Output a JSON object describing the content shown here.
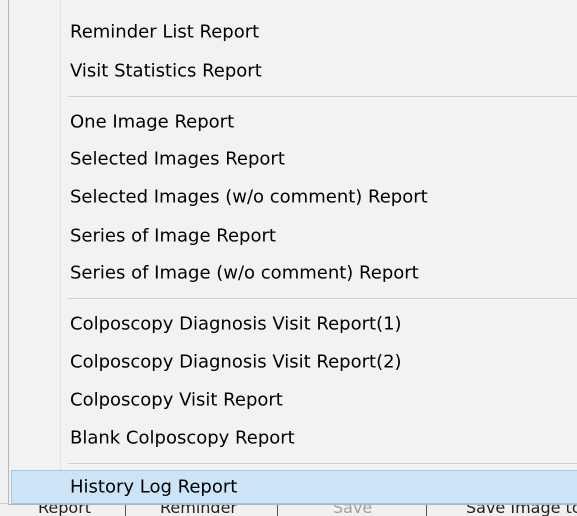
{
  "menu": {
    "groups": [
      {
        "items": [
          {
            "label": "Reminder List Report"
          },
          {
            "label": "Visit Statistics Report"
          }
        ]
      },
      {
        "items": [
          {
            "label": "One Image Report"
          },
          {
            "label": "Selected Images Report"
          },
          {
            "label": "Selected Images (w/o comment) Report"
          },
          {
            "label": "Series of Image Report"
          },
          {
            "label": "Series of Image (w/o comment) Report"
          }
        ]
      },
      {
        "items": [
          {
            "label": "Colposcopy Diagnosis Visit Report(1)"
          },
          {
            "label": "Colposcopy Diagnosis Visit Report(2)"
          },
          {
            "label": "Colposcopy Visit Report"
          },
          {
            "label": "Blank Colposcopy Report"
          }
        ]
      },
      {
        "items": [
          {
            "label": "History Log Report",
            "highlighted": true
          }
        ]
      }
    ]
  },
  "toolbar": {
    "report_label": "Report",
    "reminder_label": "Reminder",
    "save_label": "Save",
    "save_image_label": "Save Image to"
  },
  "colors": {
    "menu_background": "#f2f2f2",
    "highlight_background": "#cce4f7",
    "highlight_border": "#99c9ef"
  }
}
